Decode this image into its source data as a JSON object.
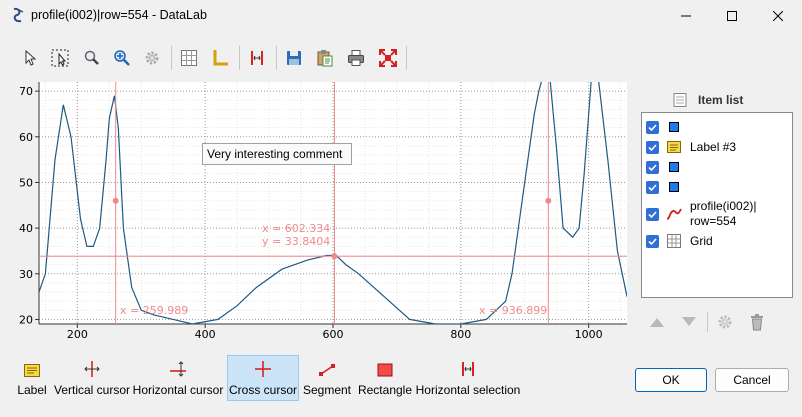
{
  "window": {
    "title": "profile(i002)|row=554 - DataLab"
  },
  "toolbar": [
    "select-arrow",
    "zoom-box",
    "zoom",
    "autoscale",
    "settings",
    "grid",
    "axes",
    "cursors",
    "save",
    "copy",
    "print",
    "fit"
  ],
  "plot": {
    "x_ticks": [
      "200",
      "400",
      "600",
      "800",
      "1000"
    ],
    "y_ticks": [
      "70",
      "60",
      "50",
      "40",
      "30",
      "20"
    ],
    "cursor_left_label": "x = 259.989",
    "cursor_right_label": "x = 936.899",
    "cross_x_label": "x = 602.334",
    "cross_y_label": "y = 33.8404",
    "comment": "Very interesting comment",
    "curve_color": "#1f5a84",
    "marker_color": "#f08a8a"
  },
  "chart_data": {
    "type": "line",
    "series": [
      {
        "x": [
          130,
          150,
          165,
          178,
          190,
          205,
          215,
          225,
          235,
          245,
          250,
          258,
          264,
          272,
          285,
          300,
          320,
          350,
          380,
          420,
          450,
          480,
          520,
          560,
          590,
          605,
          620,
          640,
          680,
          720,
          760,
          800,
          840,
          870,
          880,
          895,
          905,
          915,
          922,
          930,
          940,
          950,
          960,
          975,
          985,
          993,
          1005,
          1015,
          1030,
          1045,
          1060
        ],
        "y": [
          22,
          30,
          55,
          67,
          60,
          42,
          36,
          36,
          40,
          55,
          64,
          69,
          62,
          40,
          27,
          22,
          21,
          20,
          19,
          20,
          23,
          27,
          31,
          33,
          34,
          34,
          32,
          30,
          25,
          20,
          19,
          19,
          20,
          24,
          30,
          45,
          55,
          65,
          70,
          74,
          72,
          57,
          40,
          38,
          40,
          52,
          74,
          73,
          55,
          35,
          25
        ]
      }
    ],
    "xlim": [
      140,
      1060
    ],
    "ylim": [
      19,
      72
    ],
    "x_ticks": [
      200,
      400,
      600,
      800,
      1000
    ],
    "y_ticks": [
      20,
      30,
      40,
      50,
      60,
      70
    ],
    "vertical_cursors": [
      259.989,
      936.899
    ],
    "cross_cursor": [
      602.334,
      33.8404
    ],
    "grid": true
  },
  "item_list": {
    "title": "Item list",
    "items": [
      {
        "label": "",
        "icon": "square-marker-icon",
        "checked": true
      },
      {
        "label": "Label #3",
        "icon": "label-icon",
        "checked": true
      },
      {
        "label": "",
        "icon": "square-marker-icon",
        "checked": true
      },
      {
        "label": "",
        "icon": "square-marker-icon",
        "checked": true
      },
      {
        "label": "profile(i002)|",
        "label2": "row=554",
        "icon": "curve-icon",
        "checked": true
      },
      {
        "label": "Grid",
        "icon": "grid-icon",
        "checked": true
      }
    ]
  },
  "tools": [
    {
      "label": "Label",
      "icon": "label-icon"
    },
    {
      "label": "Vertical cursor",
      "icon": "vertical-cursor-icon"
    },
    {
      "label": "Horizontal cursor",
      "icon": "horizontal-cursor-icon"
    },
    {
      "label": "Cross cursor",
      "icon": "cross-cursor-icon",
      "active": true
    },
    {
      "label": "Segment",
      "icon": "segment-icon"
    },
    {
      "label": "Rectangle",
      "icon": "rectangle-icon"
    },
    {
      "label": "Horizontal selection",
      "icon": "horizontal-selection-icon"
    }
  ],
  "buttons": {
    "ok": "OK",
    "cancel": "Cancel"
  }
}
